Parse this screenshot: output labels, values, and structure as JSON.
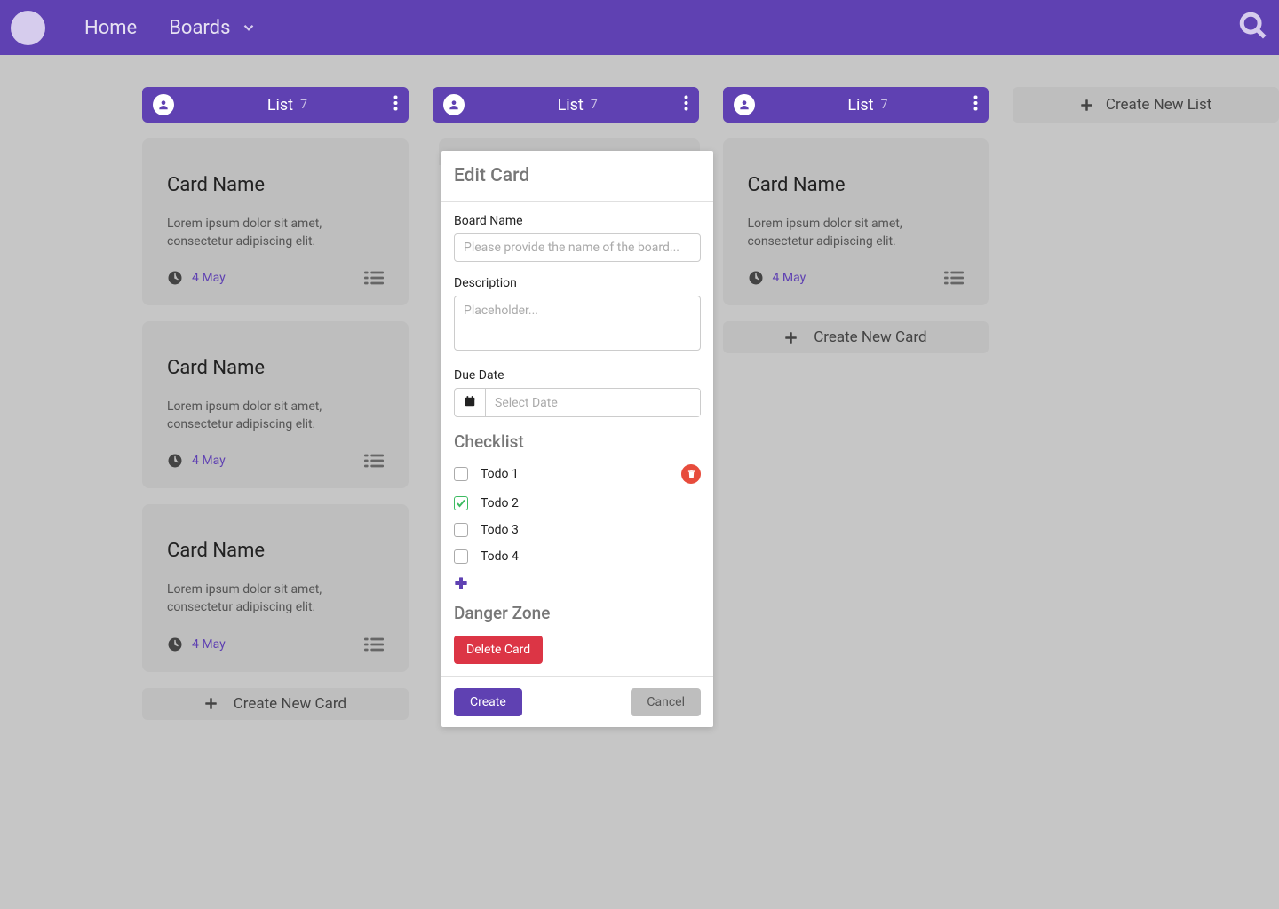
{
  "nav": {
    "home": "Home",
    "boards": "Boards"
  },
  "lists": [
    {
      "title": "List",
      "count": "7"
    },
    {
      "title": "List",
      "count": "7"
    },
    {
      "title": "List",
      "count": "7"
    }
  ],
  "card": {
    "title": "Card Name",
    "desc": "Lorem ipsum dolor sit amet, consectetur adipiscing elit.",
    "date": "4 May"
  },
  "createCard": "Create New Card",
  "createList": "Create New List",
  "modal": {
    "title": "Edit Card",
    "boardNameLabel": "Board Name",
    "boardNamePlaceholder": "Please provide the name of the board...",
    "descriptionLabel": "Description",
    "descriptionPlaceholder": "Placeholder...",
    "dueDateLabel": "Due Date",
    "dueDatePlaceholder": "Select Date",
    "checklistTitle": "Checklist",
    "checklist": [
      {
        "label": "Todo 1",
        "checked": false,
        "showDelete": true
      },
      {
        "label": "Todo 2",
        "checked": true,
        "showDelete": false
      },
      {
        "label": "Todo 3",
        "checked": false,
        "showDelete": false
      },
      {
        "label": "Todo 4",
        "checked": false,
        "showDelete": false
      }
    ],
    "dangerTitle": "Danger Zone",
    "deleteCard": "Delete Card",
    "create": "Create",
    "cancel": "Cancel"
  }
}
